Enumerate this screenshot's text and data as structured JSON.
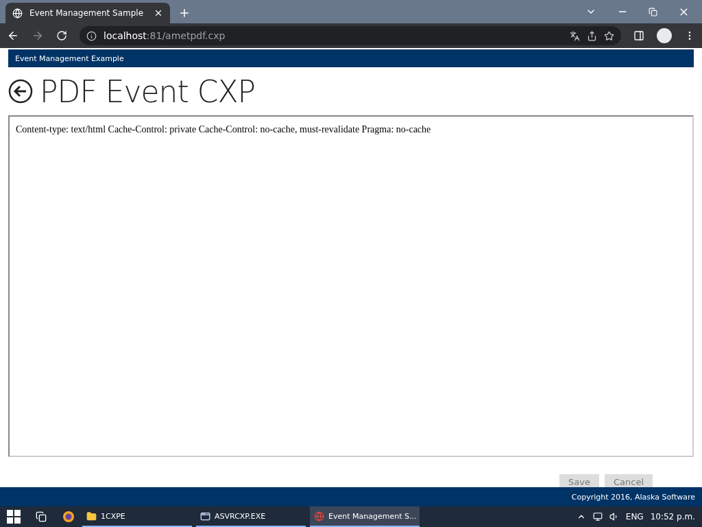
{
  "browser": {
    "tab": {
      "title": "Event Management Sample"
    },
    "url": {
      "host": "localhost",
      "rest": ":81/ametpdf.cxp"
    }
  },
  "page": {
    "header": "Event Management Example",
    "title": "PDF Event CXP",
    "content": "Content-type: text/html Cache-Control: private Cache-Control: no-cache, must-revalidate Pragma: no-cache",
    "buttons": [
      "Save",
      "Cancel"
    ],
    "footer": "Copyright 2016, Alaska Software"
  },
  "taskbar": {
    "apps": [
      {
        "label": "1CXPE",
        "kind": "folder",
        "selected": false
      },
      {
        "label": "ASVRCXP.EXE",
        "kind": "window",
        "selected": false
      },
      {
        "label": "Event Management S...",
        "kind": "browser",
        "selected": true
      }
    ],
    "language": "ENG",
    "time": "10:52 p.m."
  }
}
